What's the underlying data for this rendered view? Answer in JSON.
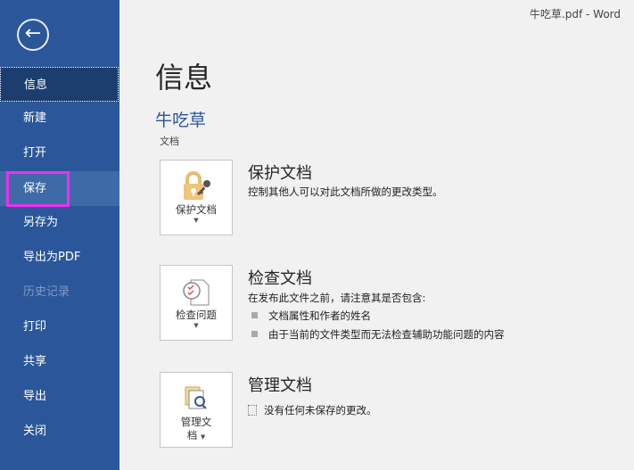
{
  "window_title": "牛吃草.pdf  -  Word",
  "sidebar": {
    "back_icon": "arrow-left-circle-icon",
    "items": [
      {
        "label": "信息",
        "state": "active"
      },
      {
        "label": "新建"
      },
      {
        "label": "打开"
      },
      {
        "label": "保存",
        "state": "hover-highlighted"
      },
      {
        "label": "另存为"
      },
      {
        "label": "导出为PDF"
      },
      {
        "label": "历史记录",
        "state": "disabled"
      },
      {
        "label": "打印"
      },
      {
        "label": "共享"
      },
      {
        "label": "导出"
      },
      {
        "label": "关闭"
      }
    ]
  },
  "main": {
    "title": "信息",
    "doc_name": "牛吃草",
    "doc_type": "文档",
    "protect": {
      "button": "保护文档",
      "heading": "保护文档",
      "desc": "控制其他人可以对此文档所做的更改类型。"
    },
    "inspect": {
      "button": "检查问题",
      "heading": "检查文档",
      "desc": "在发布此文件之前，请注意其是否包含:",
      "bullets": [
        "文档属性和作者的姓名",
        "由于当前的文件类型而无法检查辅助功能问题的内容"
      ]
    },
    "manage": {
      "button_line1": "管理文",
      "button_line2": "档",
      "heading": "管理文档",
      "desc": "没有任何未保存的更改。"
    }
  },
  "colors": {
    "sidebar": "#2b579a",
    "accent": "#2b579a",
    "highlight": "#ef2fef"
  }
}
